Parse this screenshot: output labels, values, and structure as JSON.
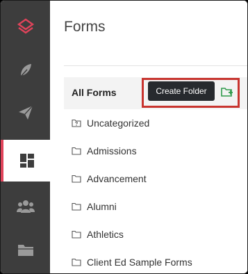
{
  "main": {
    "title": "Forms",
    "all_forms_label": "All Forms",
    "create_folder_label": "Create Folder"
  },
  "folders": [
    {
      "label": "Uncategorized",
      "icon": "folder-unknown-icon"
    },
    {
      "label": "Admissions",
      "icon": "folder-icon"
    },
    {
      "label": "Advancement",
      "icon": "folder-icon"
    },
    {
      "label": "Alumni",
      "icon": "folder-icon"
    },
    {
      "label": "Athletics",
      "icon": "folder-icon"
    },
    {
      "label": "Client Ed Sample Forms",
      "icon": "folder-icon"
    }
  ],
  "sidebar": {
    "items": [
      {
        "icon": "brand-logo-icon"
      },
      {
        "icon": "feather-icon"
      },
      {
        "icon": "paper-plane-icon"
      },
      {
        "icon": "dashboard-icon",
        "active": true
      },
      {
        "icon": "people-icon"
      },
      {
        "icon": "folder-icon"
      }
    ]
  },
  "colors": {
    "sidebar_bg": "#3d3d3d",
    "accent": "#e0435a",
    "highlight_box": "#c8342f",
    "add_folder_green": "#2e9a4a",
    "button_bg": "#272a2e"
  }
}
